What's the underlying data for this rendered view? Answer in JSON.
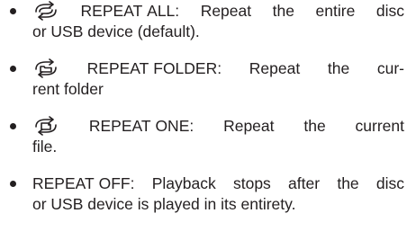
{
  "list": {
    "items": [
      {
        "icon": "repeat-all-icon",
        "line1_a": "REPEAT",
        "line1_b": "ALL:",
        "line1_c": "Repeat",
        "line1_d": "the",
        "line1_e": "entire",
        "line1_f": "disc",
        "line2": "or USB device (default)."
      },
      {
        "icon": "repeat-folder-icon",
        "line1_a": "REPEAT",
        "line1_b": "FOLDER:",
        "line1_c": "Repeat",
        "line1_d": "the",
        "line1_e": "cur-",
        "line2": "rent folder"
      },
      {
        "icon": "repeat-one-icon",
        "line1_a": "REPEAT",
        "line1_b": "ONE:",
        "line1_c": "Repeat",
        "line1_d": "the",
        "line1_e": "current",
        "line2": "file."
      },
      {
        "line1_a": "REPEAT",
        "line1_b": "OFF:",
        "line1_c": "Playback",
        "line1_d": "stops",
        "line1_e": "after",
        "line1_f": "the",
        "line1_g": "disc",
        "line2": "or USB device is played in its entirety."
      }
    ]
  }
}
